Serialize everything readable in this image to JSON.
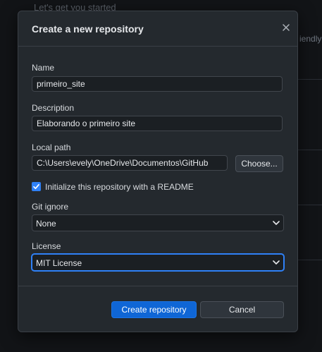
{
  "background": {
    "partial_text": "iendly",
    "top_partial_text": "Let's get you started"
  },
  "dialog": {
    "title": "Create a new repository",
    "close_icon": "close-icon"
  },
  "form": {
    "name": {
      "label": "Name",
      "value": "primeiro_site"
    },
    "description": {
      "label": "Description",
      "value": "Elaborando o primeiro site"
    },
    "local_path": {
      "label": "Local path",
      "value": "C:\\Users\\evely\\OneDrive\\Documentos\\GitHub",
      "choose_label": "Choose..."
    },
    "readme": {
      "label": "Initialize this repository with a README",
      "checked": true
    },
    "gitignore": {
      "label": "Git ignore",
      "selected": "None"
    },
    "license": {
      "label": "License",
      "selected": "MIT License"
    }
  },
  "footer": {
    "create_label": "Create repository",
    "cancel_label": "Cancel"
  },
  "colors": {
    "accent": "#2f81f7",
    "primary_button": "#0f66d6",
    "dialog_bg": "#24292e"
  }
}
